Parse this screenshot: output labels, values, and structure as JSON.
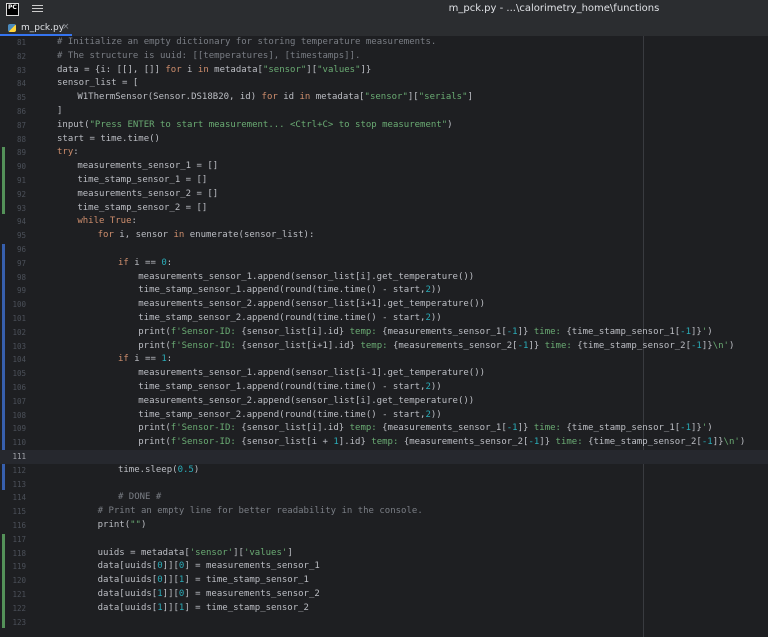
{
  "window": {
    "title": "m_pck.py - ...\\calorimetry_home\\functions",
    "app_icon_text": "PC",
    "menu_icon": "hamburger-menu-icon"
  },
  "tabs": [
    {
      "label": "m_pck.py",
      "icon": "python-file-icon",
      "close": "×",
      "active": true
    }
  ],
  "editor": {
    "current_line": 111,
    "change_markers": [
      {
        "type": "added",
        "from": 89,
        "to": 93
      },
      {
        "type": "modified",
        "from": 96,
        "to": 113
      },
      {
        "type": "added",
        "from": 117,
        "to": 123
      }
    ],
    "lines": [
      {
        "n": 81,
        "t": [
          [
            "c",
            "# Initialize an empty dictionary for storing temperature measurements."
          ]
        ],
        "indent": 4
      },
      {
        "n": 82,
        "t": [
          [
            "c",
            "# The structure is uuid: [[temperatures], [timestamps]]."
          ]
        ],
        "indent": 4
      },
      {
        "n": 83,
        "t": [
          [
            "",
            "data = {i: [[], []] "
          ],
          [
            "k",
            "for"
          ],
          [
            "",
            " i "
          ],
          [
            "k",
            "in"
          ],
          [
            "",
            " metadata["
          ],
          [
            "s",
            "\"sensor\""
          ],
          [
            "",
            "]["
          ],
          [
            "s",
            "\"values\""
          ],
          [
            "",
            "]}"
          ]
        ],
        "indent": 4
      },
      {
        "n": 84,
        "t": [
          [
            "",
            "sensor_list = ["
          ]
        ],
        "indent": 4
      },
      {
        "n": 85,
        "t": [
          [
            "",
            "W1ThermSensor(Sensor.DS18B20, id) "
          ],
          [
            "k",
            "for"
          ],
          [
            "",
            " id "
          ],
          [
            "k",
            "in"
          ],
          [
            "",
            " metadata["
          ],
          [
            "s",
            "\"sensor\""
          ],
          [
            "",
            "]["
          ],
          [
            "s",
            "\"serials\""
          ],
          [
            "",
            "]"
          ]
        ],
        "indent": 8
      },
      {
        "n": 86,
        "t": [
          [
            "",
            "]"
          ]
        ],
        "indent": 4
      },
      {
        "n": 87,
        "t": [
          [
            "",
            "input("
          ],
          [
            "s",
            "\"Press ENTER to start measurement... <Ctrl+C> to stop measurement\""
          ],
          [
            "",
            ")"
          ]
        ],
        "indent": 4
      },
      {
        "n": 88,
        "t": [
          [
            "",
            "start = time.time()"
          ]
        ],
        "indent": 4
      },
      {
        "n": 89,
        "t": [
          [
            "k",
            "try"
          ],
          [
            "",
            ":"
          ]
        ],
        "indent": 4
      },
      {
        "n": 90,
        "t": [
          [
            "",
            "measurements_sensor_1 = []"
          ]
        ],
        "indent": 8
      },
      {
        "n": 91,
        "t": [
          [
            "",
            "time_stamp_sensor_1 = []"
          ]
        ],
        "indent": 8
      },
      {
        "n": 92,
        "t": [
          [
            "",
            "measurements_sensor_2 = []"
          ]
        ],
        "indent": 8
      },
      {
        "n": 93,
        "t": [
          [
            "",
            "time_stamp_sensor_2 = []"
          ]
        ],
        "indent": 8
      },
      {
        "n": 94,
        "t": [
          [
            "k",
            "while"
          ],
          [
            "",
            " "
          ],
          [
            "k",
            "True"
          ],
          [
            "",
            ":"
          ]
        ],
        "indent": 8
      },
      {
        "n": 95,
        "t": [
          [
            "k",
            "for"
          ],
          [
            "",
            " i, sensor "
          ],
          [
            "k",
            "in"
          ],
          [
            "",
            " enumerate(sensor_list):"
          ]
        ],
        "indent": 12
      },
      {
        "n": 96,
        "t": [],
        "indent": 0
      },
      {
        "n": 97,
        "t": [
          [
            "k",
            "if"
          ],
          [
            "",
            " i == "
          ],
          [
            "n",
            "0"
          ],
          [
            "",
            ":"
          ]
        ],
        "indent": 16
      },
      {
        "n": 98,
        "t": [
          [
            "",
            "measurements_sensor_1.append(sensor_list[i].get_temperature())"
          ]
        ],
        "indent": 20
      },
      {
        "n": 99,
        "t": [
          [
            "",
            "time_stamp_sensor_1.append(round(time.time() - start,"
          ],
          [
            "n",
            "2"
          ],
          [
            "",
            "))"
          ]
        ],
        "indent": 20
      },
      {
        "n": 100,
        "t": [
          [
            "",
            "measurements_sensor_2.append(sensor_list[i+1].get_temperature())"
          ]
        ],
        "indent": 20
      },
      {
        "n": 101,
        "t": [
          [
            "",
            "time_stamp_sensor_2.append(round(time.time() - start,"
          ],
          [
            "n",
            "2"
          ],
          [
            "",
            "))"
          ]
        ],
        "indent": 20
      },
      {
        "n": 102,
        "t": [
          [
            "",
            "print("
          ],
          [
            "s",
            "f'Sensor-ID: "
          ],
          [
            "",
            "{sensor_list[i].id}"
          ],
          [
            "s",
            " temp: "
          ],
          [
            "",
            "{measurements_sensor_1["
          ],
          [
            "n",
            "-1"
          ],
          [
            "",
            "]}"
          ],
          [
            "s",
            " time: "
          ],
          [
            "",
            "{time_stamp_sensor_1["
          ],
          [
            "n",
            "-1"
          ],
          [
            "",
            "]}"
          ],
          [
            "s",
            "'"
          ],
          [
            "",
            ")"
          ]
        ],
        "indent": 20
      },
      {
        "n": 103,
        "t": [
          [
            "",
            "print("
          ],
          [
            "s",
            "f'Sensor-ID: "
          ],
          [
            "",
            "{sensor_list[i+1].id}"
          ],
          [
            "s",
            " temp: "
          ],
          [
            "",
            "{measurements_sensor_2["
          ],
          [
            "n",
            "-1"
          ],
          [
            "",
            "]}"
          ],
          [
            "s",
            " time: "
          ],
          [
            "",
            "{time_stamp_sensor_2["
          ],
          [
            "n",
            "-1"
          ],
          [
            "",
            "]}"
          ],
          [
            "s",
            "\\n'"
          ],
          [
            "",
            ")"
          ]
        ],
        "indent": 20
      },
      {
        "n": 104,
        "t": [
          [
            "k",
            "if"
          ],
          [
            "",
            " i == "
          ],
          [
            "n",
            "1"
          ],
          [
            "",
            ":"
          ]
        ],
        "indent": 16
      },
      {
        "n": 105,
        "t": [
          [
            "",
            "measurements_sensor_1.append(sensor_list[i-1].get_temperature())"
          ]
        ],
        "indent": 20
      },
      {
        "n": 106,
        "t": [
          [
            "",
            "time_stamp_sensor_1.append(round(time.time() - start,"
          ],
          [
            "n",
            "2"
          ],
          [
            "",
            "))"
          ]
        ],
        "indent": 20
      },
      {
        "n": 107,
        "t": [
          [
            "",
            "measurements_sensor_2.append(sensor_list[i].get_temperature())"
          ]
        ],
        "indent": 20
      },
      {
        "n": 108,
        "t": [
          [
            "",
            "time_stamp_sensor_2.append(round(time.time() - start,"
          ],
          [
            "n",
            "2"
          ],
          [
            "",
            "))"
          ]
        ],
        "indent": 20
      },
      {
        "n": 109,
        "t": [
          [
            "",
            "print("
          ],
          [
            "s",
            "f'Sensor-ID: "
          ],
          [
            "",
            "{sensor_list[i].id}"
          ],
          [
            "s",
            " temp: "
          ],
          [
            "",
            "{measurements_sensor_1["
          ],
          [
            "n",
            "-1"
          ],
          [
            "",
            "]}"
          ],
          [
            "s",
            " time: "
          ],
          [
            "",
            "{time_stamp_sensor_1["
          ],
          [
            "n",
            "-1"
          ],
          [
            "",
            "]}"
          ],
          [
            "s",
            "'"
          ],
          [
            "",
            ")"
          ]
        ],
        "indent": 20
      },
      {
        "n": 110,
        "t": [
          [
            "",
            "print("
          ],
          [
            "s",
            "f'Sensor-ID: "
          ],
          [
            "",
            "{sensor_list[i + "
          ],
          [
            "n",
            "1"
          ],
          [
            "",
            "].id}"
          ],
          [
            "s",
            " temp: "
          ],
          [
            "",
            "{measurements_sensor_2["
          ],
          [
            "n",
            "-1"
          ],
          [
            "",
            "]}"
          ],
          [
            "s",
            " time: "
          ],
          [
            "",
            "{time_stamp_sensor_2["
          ],
          [
            "n",
            "-1"
          ],
          [
            "",
            "]}"
          ],
          [
            "s",
            "\\n'"
          ],
          [
            "",
            ")"
          ]
        ],
        "indent": 20
      },
      {
        "n": 111,
        "t": [],
        "indent": 0
      },
      {
        "n": 112,
        "t": [
          [
            "",
            "time.sleep("
          ],
          [
            "n",
            "0.5"
          ],
          [
            "",
            ")"
          ]
        ],
        "indent": 16
      },
      {
        "n": 113,
        "t": [],
        "indent": 0
      },
      {
        "n": 114,
        "t": [
          [
            "c",
            "# DONE #"
          ]
        ],
        "indent": 16
      },
      {
        "n": 115,
        "t": [
          [
            "c",
            "# Print an empty line for better readability in the console."
          ]
        ],
        "indent": 12
      },
      {
        "n": 116,
        "t": [
          [
            "",
            "print("
          ],
          [
            "s",
            "\"\""
          ],
          [
            "",
            ")"
          ]
        ],
        "indent": 12
      },
      {
        "n": 117,
        "t": [],
        "indent": 0
      },
      {
        "n": 118,
        "t": [
          [
            "",
            "uuids = metadata["
          ],
          [
            "s",
            "'sensor'"
          ],
          [
            "",
            "]["
          ],
          [
            "s",
            "'values'"
          ],
          [
            "",
            "]"
          ]
        ],
        "indent": 12
      },
      {
        "n": 119,
        "t": [
          [
            "",
            "data[uuids["
          ],
          [
            "n",
            "0"
          ],
          [
            "",
            "]]["
          ],
          [
            "n",
            "0"
          ],
          [
            "",
            "] = measurements_sensor_1"
          ]
        ],
        "indent": 12
      },
      {
        "n": 120,
        "t": [
          [
            "",
            "data[uuids["
          ],
          [
            "n",
            "0"
          ],
          [
            "",
            "]]["
          ],
          [
            "n",
            "1"
          ],
          [
            "",
            "] = time_stamp_sensor_1"
          ]
        ],
        "indent": 12
      },
      {
        "n": 121,
        "t": [
          [
            "",
            "data[uuids["
          ],
          [
            "n",
            "1"
          ],
          [
            "",
            "]]["
          ],
          [
            "n",
            "0"
          ],
          [
            "",
            "] = measurements_sensor_2"
          ]
        ],
        "indent": 12
      },
      {
        "n": 122,
        "t": [
          [
            "",
            "data[uuids["
          ],
          [
            "n",
            "1"
          ],
          [
            "",
            "]]["
          ],
          [
            "n",
            "1"
          ],
          [
            "",
            "] = time_stamp_sensor_2"
          ]
        ],
        "indent": 12
      },
      {
        "n": 123,
        "t": [],
        "indent": 0
      }
    ]
  }
}
